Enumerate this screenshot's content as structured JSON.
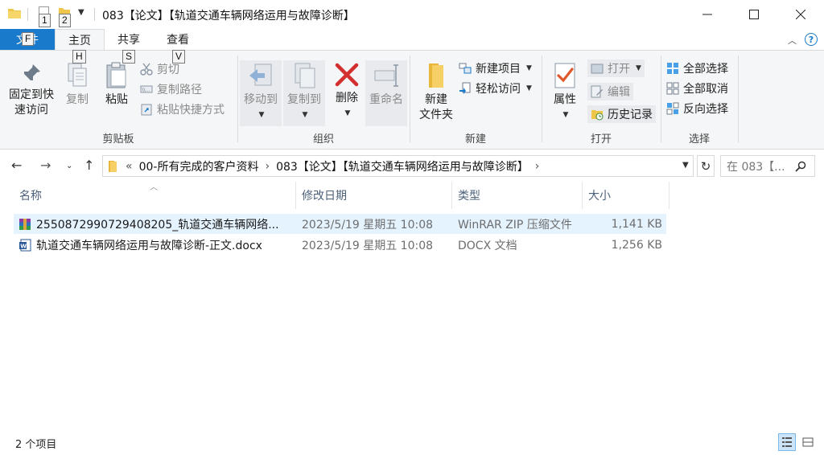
{
  "window": {
    "title": "083【论文】【轨道交通车辆网络运用与故障诊断】",
    "keytips": [
      "1",
      "2"
    ]
  },
  "tabs": {
    "file": "文件",
    "file_keytip": "F",
    "home": "主页",
    "home_keytip": "H",
    "share": "共享",
    "share_keytip": "S",
    "view": "查看",
    "view_keytip": "V"
  },
  "ribbon": {
    "clipboard": {
      "label": "剪贴板",
      "pin_line1": "固定到快",
      "pin_line2": "速访问",
      "copy": "复制",
      "paste": "粘贴",
      "cut": "剪切",
      "copy_path": "复制路径",
      "paste_shortcut": "粘贴快捷方式"
    },
    "organize": {
      "label": "组织",
      "move_to": "移动到",
      "copy_to": "复制到",
      "delete": "删除",
      "rename": "重命名"
    },
    "new": {
      "label": "新建",
      "new_folder_line1": "新建",
      "new_folder_line2": "文件夹",
      "new_item": "新建项目",
      "easy_access": "轻松访问"
    },
    "open": {
      "label": "打开",
      "properties": "属性",
      "open": "打开",
      "edit": "编辑",
      "history": "历史记录"
    },
    "select": {
      "label": "选择",
      "select_all": "全部选择",
      "select_none": "全部取消",
      "invert": "反向选择"
    }
  },
  "address": {
    "overflow": "«",
    "crumbs": [
      "00-所有完成的客户资料",
      "083【论文】【轨道交通车辆网络运用与故障诊断】"
    ],
    "separator": "›",
    "search_placeholder": "在 083【..."
  },
  "columns": [
    "名称",
    "修改日期",
    "类型",
    "大小"
  ],
  "files": [
    {
      "name": "2550872990729408205_轨道交通车辆网络...",
      "date": "2023/5/19 星期五 10:08",
      "type": "WinRAR ZIP 压缩文件",
      "size": "1,141 KB",
      "icon": "winrar-zip-icon",
      "selected": true
    },
    {
      "name": "轨道交通车辆网络运用与故障诊断-正文.docx",
      "date": "2023/5/19 星期五 10:08",
      "type": "DOCX 文档",
      "size": "1,256 KB",
      "icon": "word-docx-icon",
      "selected": false
    }
  ],
  "status": {
    "item_count": "2 个项目"
  },
  "colors": {
    "accent": "#1979ca",
    "selection": "#e5f3ff",
    "folder": "#f0c64a",
    "delete_red": "#d32f2f"
  }
}
